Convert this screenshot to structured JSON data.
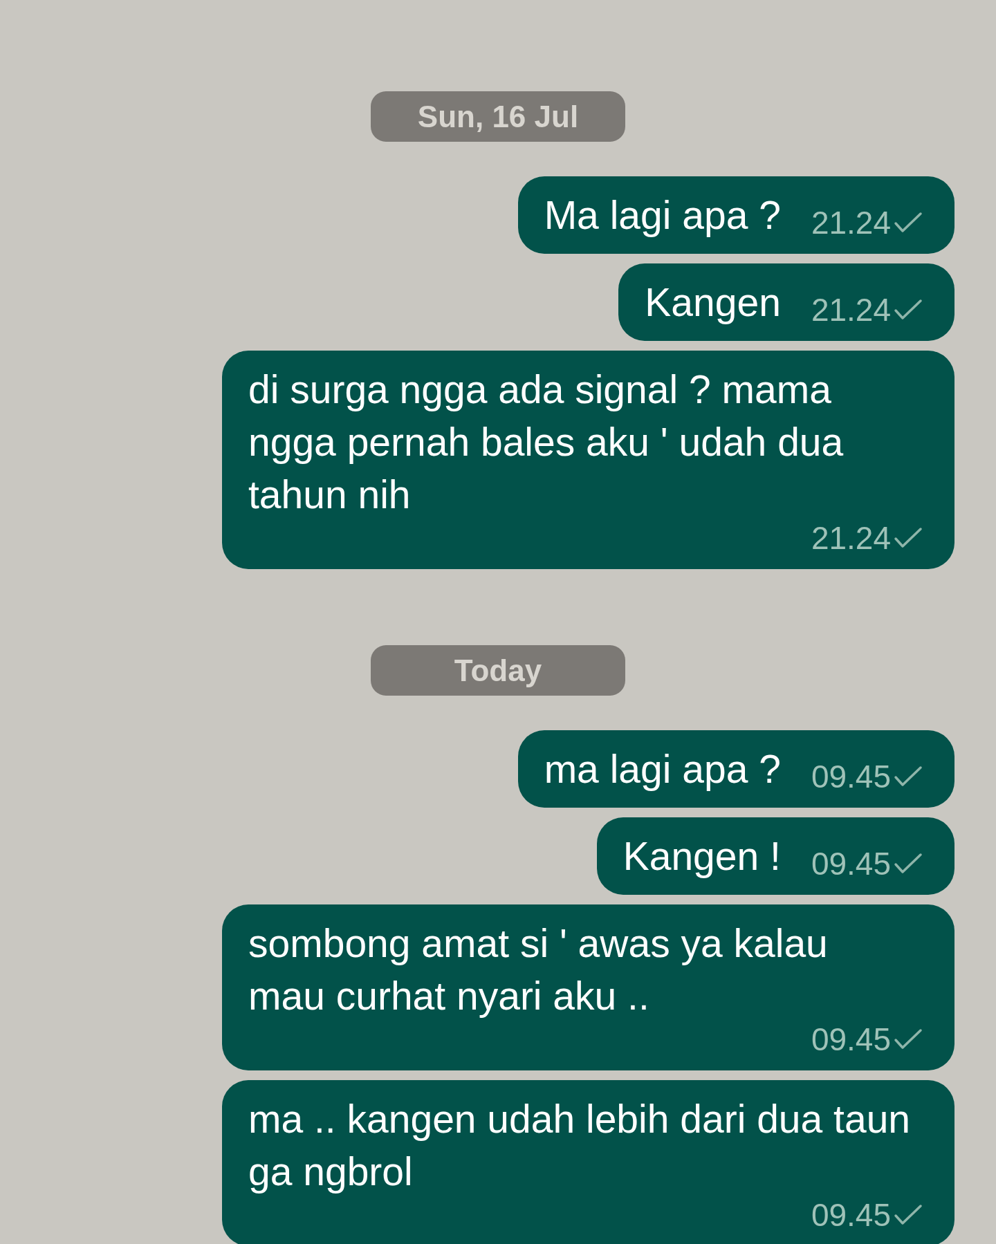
{
  "chat": [
    {
      "kind": "date",
      "label": "Sun, 16 Jul"
    },
    {
      "kind": "message",
      "text": "Ma lagi apa ?",
      "time": "21.24",
      "delivered": false
    },
    {
      "kind": "message",
      "text": "Kangen",
      "time": "21.24",
      "delivered": false
    },
    {
      "kind": "message",
      "text": "di surga ngga ada signal ? mama ngga pernah bales aku ' udah dua tahun nih",
      "time": "21.24",
      "delivered": false
    },
    {
      "kind": "date",
      "label": "Today"
    },
    {
      "kind": "message",
      "text": "ma lagi apa ?",
      "time": "09.45",
      "delivered": false
    },
    {
      "kind": "message",
      "text": "Kangen !",
      "time": "09.45",
      "delivered": false
    },
    {
      "kind": "message",
      "text": "sombong amat si ' awas ya kalau mau curhat nyari aku ..",
      "time": "09.45",
      "delivered": false
    },
    {
      "kind": "message",
      "text": "ma .. kangen udah lebih dari dua taun ga ngbrol",
      "time": "09.45",
      "delivered": false
    }
  ]
}
